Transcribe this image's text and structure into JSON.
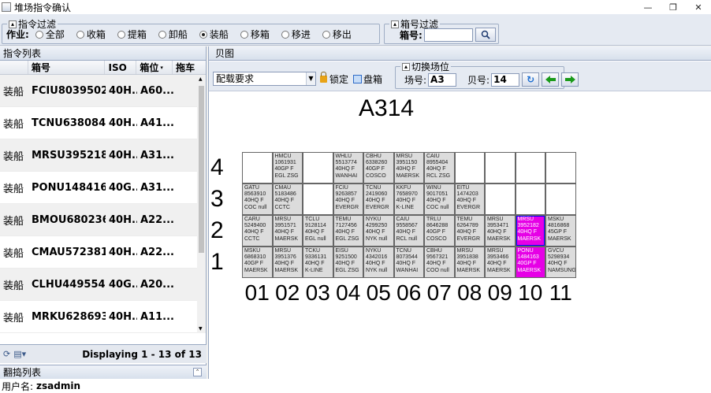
{
  "window": {
    "title": "堆场指令确认",
    "minimize": "—",
    "restore": "❐",
    "close": "✕"
  },
  "command_filter": {
    "legend": "指令过滤",
    "label": "作业:",
    "options": [
      "全部",
      "收箱",
      "提箱",
      "卸船",
      "装船",
      "移箱",
      "移进",
      "移出"
    ],
    "selected": "装船"
  },
  "box_filter": {
    "legend": "箱号过滤",
    "label": "箱号:",
    "value": "",
    "search_icon": "magnifier-icon"
  },
  "command_list": {
    "title": "指令列表",
    "columns": [
      "",
      "箱号",
      "ISO",
      "箱位",
      "拖车"
    ],
    "rows": [
      {
        "op": "装船",
        "box": "FCIU8039502",
        "iso": "40H...",
        "pos": "A60..."
      },
      {
        "op": "装船",
        "box": "TCNU6380840",
        "iso": "40H...",
        "pos": "A41..."
      },
      {
        "op": "装船",
        "box": "MRSU3952182",
        "iso": "40H...",
        "pos": "A31..."
      },
      {
        "op": "装船",
        "box": "PONU1484163",
        "iso": "40G...",
        "pos": "A31..."
      },
      {
        "op": "装船",
        "box": "BMOU6802366",
        "iso": "40H...",
        "pos": "A22..."
      },
      {
        "op": "装船",
        "box": "CMAU5723814",
        "iso": "40H...",
        "pos": "A22..."
      },
      {
        "op": "装船",
        "box": "CLHU4495548",
        "iso": "40G...",
        "pos": "A20..."
      },
      {
        "op": "装船",
        "box": "MRKU6286934",
        "iso": "40H...",
        "pos": "A11..."
      }
    ],
    "pager": "Displaying 1 - 13 of 13"
  },
  "flip_list": {
    "title": "翻捣列表"
  },
  "status": {
    "user_label": "用户名:",
    "user": "zsadmin"
  },
  "bay_view": {
    "title": "贝图",
    "stow_req": "配载要求",
    "lock": "锁定",
    "inventory": "盘箱",
    "switch": {
      "legend": "切换场位",
      "area_label": "场号:",
      "area": "A3",
      "bay_label": "贝号:",
      "bay": "14"
    },
    "bay_title": "A314",
    "tiers": [
      "4",
      "3",
      "2",
      "1"
    ],
    "rows": [
      "01",
      "02",
      "03",
      "04",
      "05",
      "06",
      "07",
      "08",
      "09",
      "10",
      "11"
    ],
    "cells": {
      "4": [
        "",
        "HMCU|1061931|40GP F|EGL ZSG",
        "",
        "WHLU|5513774|40HQ F|WANHAI",
        "CBHU|6338260|40GP F|COSCO",
        "MRSU|3951150|40HQ F|MAERSK",
        "CAIU|8955404|40HQ F|RCL ZSG",
        "",
        "",
        "",
        ""
      ],
      "3": [
        "GATU|8563910|40HQ F|COC null",
        "CMAU|5183486|40HQ F|CCTC",
        "",
        "FCIU|9263857|40HQ F|EVERGR",
        "TCNU|2419060|40HQ F|EVERGR",
        "KKFU|7658970|40HQ F|K-LINE",
        "WINU|9017051|40HQ F|COC null",
        "EITU|1474203|40HQ F|EVERGR",
        "",
        "",
        ""
      ],
      "2": [
        "CARU|5249400|40HQ F|CCTC",
        "MRSU|3951571|40HQ F|MAERSK",
        "TCLU|9128114|40HQ F|EGL null",
        "TEMU|7127456|40HQ F|EGL ZSG",
        "NYKU|4299250|40HQ F|NYK null",
        "CAIU|9558567|40HQ F|RCL null",
        "TRLU|8646288|40GP F|COSCO",
        "TEMU|6264789|40HQ F|EVERGR",
        "MRSU|3953471|40HQ F|MAERSK",
        "MRSU|3952182|40HQ F|MAERSK",
        "MSKU|4816868|45GP F|MAERSK"
      ],
      "1": [
        "MSKU|6868310|40GP F|MAERSK",
        "MRSU|3951376|40HQ F|MAERSK",
        "TCKU|9336131|40HQ F|K-LINE",
        "EISU|9251500|40HQ F|EGL ZSG",
        "NYKU|4342016|40HQ F|NYK null",
        "TCNU|8073544|40HQ F|WANHAI",
        "CBHU|9567321|40HQ F|COO null",
        "MRSU|3951838|40HQ F|MAERSK",
        "MRSU|3953466|40HQ F|MAERSK",
        "PONU|1484163|40GP F|MAERSK",
        "GVCU|5298934|40HQ F|NAMSUNG"
      ]
    },
    "highlight": [
      {
        "tier": "2",
        "col": 9
      },
      {
        "tier": "1",
        "col": 9
      }
    ],
    "highlight_color": "#e600e6"
  }
}
